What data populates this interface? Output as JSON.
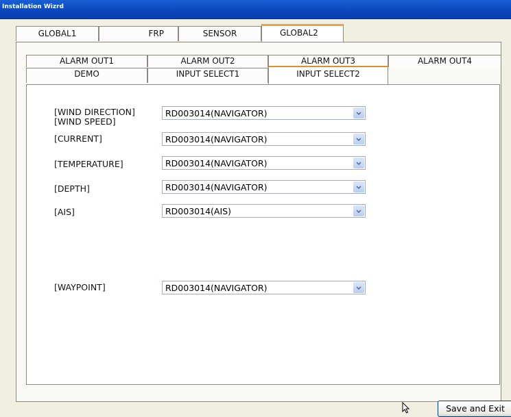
{
  "window": {
    "title": "Installation Wizrd"
  },
  "main_tabs": [
    {
      "label": "GLOBAL1",
      "selected": false
    },
    {
      "label": "FRP",
      "selected": false
    },
    {
      "label": "SENSOR",
      "selected": false
    },
    {
      "label": "GLOBAL2",
      "selected": true
    }
  ],
  "sub_tabs_row1": [
    {
      "label": "ALARM OUT1"
    },
    {
      "label": "ALARM OUT2"
    },
    {
      "label": "ALARM OUT3"
    },
    {
      "label": "ALARM OUT4"
    }
  ],
  "sub_tabs_row2": [
    {
      "label": "DEMO",
      "selected": false
    },
    {
      "label": "INPUT SELECT1",
      "selected": false
    },
    {
      "label": "INPUT SELECT2",
      "selected": true
    }
  ],
  "form": {
    "wind": {
      "label1": "[WIND DIRECTION]",
      "label2": "[WIND SPEED]",
      "value": "RD003014(NAVIGATOR)"
    },
    "current": {
      "label": "[CURRENT]",
      "value": "RD003014(NAVIGATOR)"
    },
    "temperature": {
      "label": "[TEMPERATURE]",
      "value": "RD003014(NAVIGATOR)"
    },
    "depth": {
      "label": "[DEPTH]",
      "value": "RD003014(NAVIGATOR)"
    },
    "ais": {
      "label": "[AIS]",
      "value": "RD003014(AIS)"
    },
    "waypoint": {
      "label": "[WAYPOINT]",
      "value": "RD003014(NAVIGATOR)"
    }
  },
  "footer": {
    "save_label": "Save and Exit"
  },
  "colors": {
    "titlebar": "#0b46bd",
    "selected_tab_accent": "#f0a43b",
    "combo_button": "#b9cdf3"
  },
  "icons": {
    "dropdown": "chevron-down-icon",
    "cursor": "mouse-cursor-icon"
  }
}
